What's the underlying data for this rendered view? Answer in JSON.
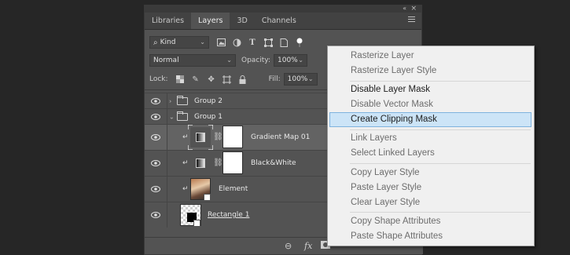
{
  "panel": {
    "tabs": [
      "Libraries",
      "Layers",
      "3D",
      "Channels"
    ],
    "active_tab": "Layers",
    "filter": {
      "value": "Kind"
    },
    "blend": {
      "value": "Normal"
    },
    "opacity": {
      "label": "Opacity:",
      "value": "100%"
    },
    "lock": {
      "label": "Lock:"
    },
    "fill": {
      "label": "Fill:",
      "value": "100%"
    },
    "icons": {
      "collapse": "«",
      "close": "×",
      "search": "⌕",
      "clip": "↵",
      "chain": "⛓",
      "fx": "fx",
      "link": "⊖"
    },
    "layers": [
      {
        "name": "Group 2",
        "type": "group",
        "expanded": false
      },
      {
        "name": "Group 1",
        "type": "group",
        "expanded": true
      },
      {
        "name": "Gradient Map 01",
        "type": "adjustment",
        "clipped": true,
        "selected": true
      },
      {
        "name": "Black&White",
        "type": "adjustment",
        "clipped": true
      },
      {
        "name": "Element",
        "type": "smart-object",
        "clipped": true
      },
      {
        "name": "Rectangle 1",
        "type": "shape"
      }
    ]
  },
  "context_menu": {
    "items": [
      {
        "label": "Rasterize Layer",
        "enabled": false
      },
      {
        "label": "Rasterize Layer Style",
        "enabled": false
      },
      {
        "label": "Disable Layer Mask",
        "enabled": true
      },
      {
        "label": "Disable Vector Mask",
        "enabled": false
      },
      {
        "label": "Create Clipping Mask",
        "enabled": true,
        "highlighted": true
      },
      {
        "label": "Link Layers",
        "enabled": false
      },
      {
        "label": "Select Linked Layers",
        "enabled": false
      },
      {
        "label": "Copy Layer Style",
        "enabled": false
      },
      {
        "label": "Paste Layer Style",
        "enabled": false
      },
      {
        "label": "Clear Layer Style",
        "enabled": false
      },
      {
        "label": "Copy Shape Attributes",
        "enabled": false
      },
      {
        "label": "Paste Shape Attributes",
        "enabled": false
      }
    ]
  },
  "colors": {
    "app_bg": "#262626",
    "panel_bg": "#535353",
    "selected_row": "#636363",
    "menu_bg": "#f0f0f0",
    "menu_highlight": "#cce4f7"
  }
}
